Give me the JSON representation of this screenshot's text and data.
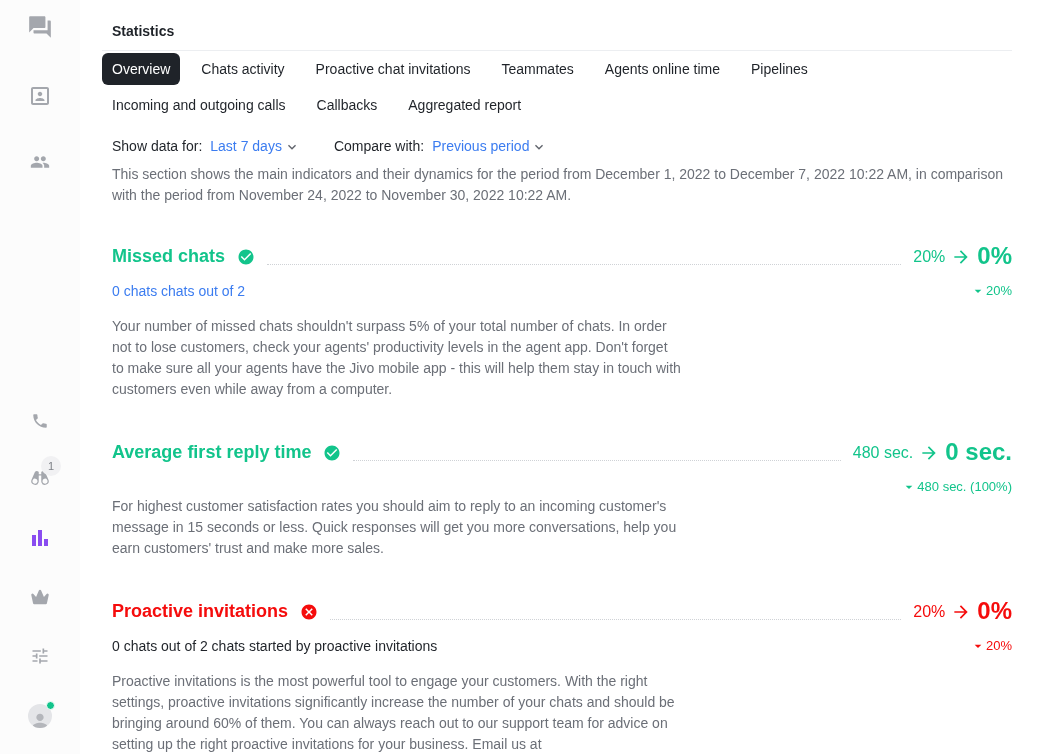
{
  "sidebar": {
    "top_items": [
      {
        "kind": "chats",
        "selected": false
      },
      {
        "kind": "contacts",
        "selected": false
      },
      {
        "kind": "team",
        "selected": false
      }
    ],
    "bottom_items": [
      {
        "kind": "calls",
        "selected": false
      },
      {
        "kind": "monitoring",
        "selected": false,
        "badge": "1"
      },
      {
        "kind": "statistics",
        "selected": true
      },
      {
        "kind": "plan",
        "selected": false
      },
      {
        "kind": "settings",
        "selected": false
      },
      {
        "kind": "profile",
        "selected": false,
        "online": true
      }
    ]
  },
  "title": "Statistics",
  "tabs": [
    {
      "label": "Overview",
      "selected": true
    },
    {
      "label": "Chats activity",
      "selected": false
    },
    {
      "label": "Proactive chat invitations",
      "selected": false
    },
    {
      "label": "Teammates",
      "selected": false
    },
    {
      "label": "Agents online time",
      "selected": false
    },
    {
      "label": "Pipelines",
      "selected": false
    },
    {
      "label": "Incoming and outgoing calls",
      "selected": false
    },
    {
      "label": "Callbacks",
      "selected": false
    },
    {
      "label": "Aggregated report",
      "selected": false
    }
  ],
  "filters": [
    {
      "label": "Show data for:",
      "value": "Last 7 days"
    },
    {
      "label": "Compare with:",
      "value": "Previous period"
    }
  ],
  "intro": "This section shows the main indicators and their dynamics for the period from December 1, 2022 to December 7, 2022 10:22 AM, in comparison with the period from November 24, 2022 to November 30, 2022 10:22 AM.",
  "metrics": [
    {
      "title": "Missed chats",
      "achieved": true,
      "previous": "20%",
      "current": "0%",
      "subtitle": {
        "kind": "link",
        "text": "0 chats chats out of 2"
      },
      "change": "20%",
      "description": "Your number of missed chats shouldn't surpass 5% of your total number of chats. In order not to lose customers, check your agents' productivity levels in the agent app. Don't forget to make sure all your agents have the Jivo mobile app - this will help them stay in touch with customers even while away from a computer."
    },
    {
      "title": "Average first reply time",
      "achieved": true,
      "previous": "480 sec.",
      "current": "0 sec.",
      "change": "480 sec. (100%)",
      "description": "For highest customer satisfaction rates you should aim to reply to an incoming customer's message in 15 seconds or less. Quick responses will get you more conversations, help you earn customers' trust and make more sales."
    },
    {
      "title": "Proactive invitations",
      "achieved": false,
      "previous": "20%",
      "current": "0%",
      "subtitle": {
        "kind": "plain",
        "text": "0 chats out of 2 chats started by proactive invitations"
      },
      "change": "20%",
      "description": "Proactive invitations is the most powerful tool to engage your customers. With the right settings, proactive invitations significantly increase the number of your chats and should be bringing around 60% of them. You can always reach out to our support team for advice on setting up the right proactive invitations for your business. Email us at"
    }
  ]
}
